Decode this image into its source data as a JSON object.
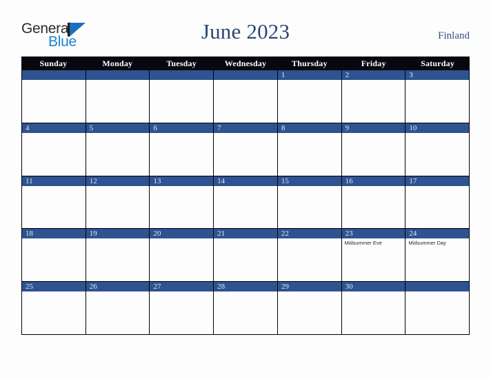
{
  "brand": {
    "name_part1": "General",
    "name_part2": "Blue",
    "triangle_color": "#1b6fc0",
    "blue_color": "#1b84d0",
    "general_color": "#2b2b2b"
  },
  "header": {
    "title": "June 2023",
    "country": "Finland",
    "title_color": "#2d4671",
    "country_color": "#33517e"
  },
  "calendar": {
    "weekdays": [
      "Sunday",
      "Monday",
      "Tuesday",
      "Wednesday",
      "Thursday",
      "Friday",
      "Saturday"
    ],
    "weekday_bg": "#07070f",
    "weekday_fg": "#ffffff",
    "date_bar_color": "#2e5390",
    "date_text_color": "#e8eaf0",
    "cell_bg": "#fdfdfd",
    "border_color": "#000000",
    "weeks": [
      [
        {
          "date": "",
          "events": []
        },
        {
          "date": "",
          "events": []
        },
        {
          "date": "",
          "events": []
        },
        {
          "date": "",
          "events": []
        },
        {
          "date": "1",
          "events": []
        },
        {
          "date": "2",
          "events": []
        },
        {
          "date": "3",
          "events": []
        }
      ],
      [
        {
          "date": "4",
          "events": []
        },
        {
          "date": "5",
          "events": []
        },
        {
          "date": "6",
          "events": []
        },
        {
          "date": "7",
          "events": []
        },
        {
          "date": "8",
          "events": []
        },
        {
          "date": "9",
          "events": []
        },
        {
          "date": "10",
          "events": []
        }
      ],
      [
        {
          "date": "11",
          "events": []
        },
        {
          "date": "12",
          "events": []
        },
        {
          "date": "13",
          "events": []
        },
        {
          "date": "14",
          "events": []
        },
        {
          "date": "15",
          "events": []
        },
        {
          "date": "16",
          "events": []
        },
        {
          "date": "17",
          "events": []
        }
      ],
      [
        {
          "date": "18",
          "events": []
        },
        {
          "date": "19",
          "events": []
        },
        {
          "date": "20",
          "events": []
        },
        {
          "date": "21",
          "events": []
        },
        {
          "date": "22",
          "events": []
        },
        {
          "date": "23",
          "events": [
            "Midsummer Eve"
          ]
        },
        {
          "date": "24",
          "events": [
            "Midsummer Day"
          ]
        }
      ],
      [
        {
          "date": "25",
          "events": []
        },
        {
          "date": "26",
          "events": []
        },
        {
          "date": "27",
          "events": []
        },
        {
          "date": "28",
          "events": []
        },
        {
          "date": "29",
          "events": []
        },
        {
          "date": "30",
          "events": []
        },
        {
          "date": "",
          "events": []
        }
      ]
    ]
  }
}
